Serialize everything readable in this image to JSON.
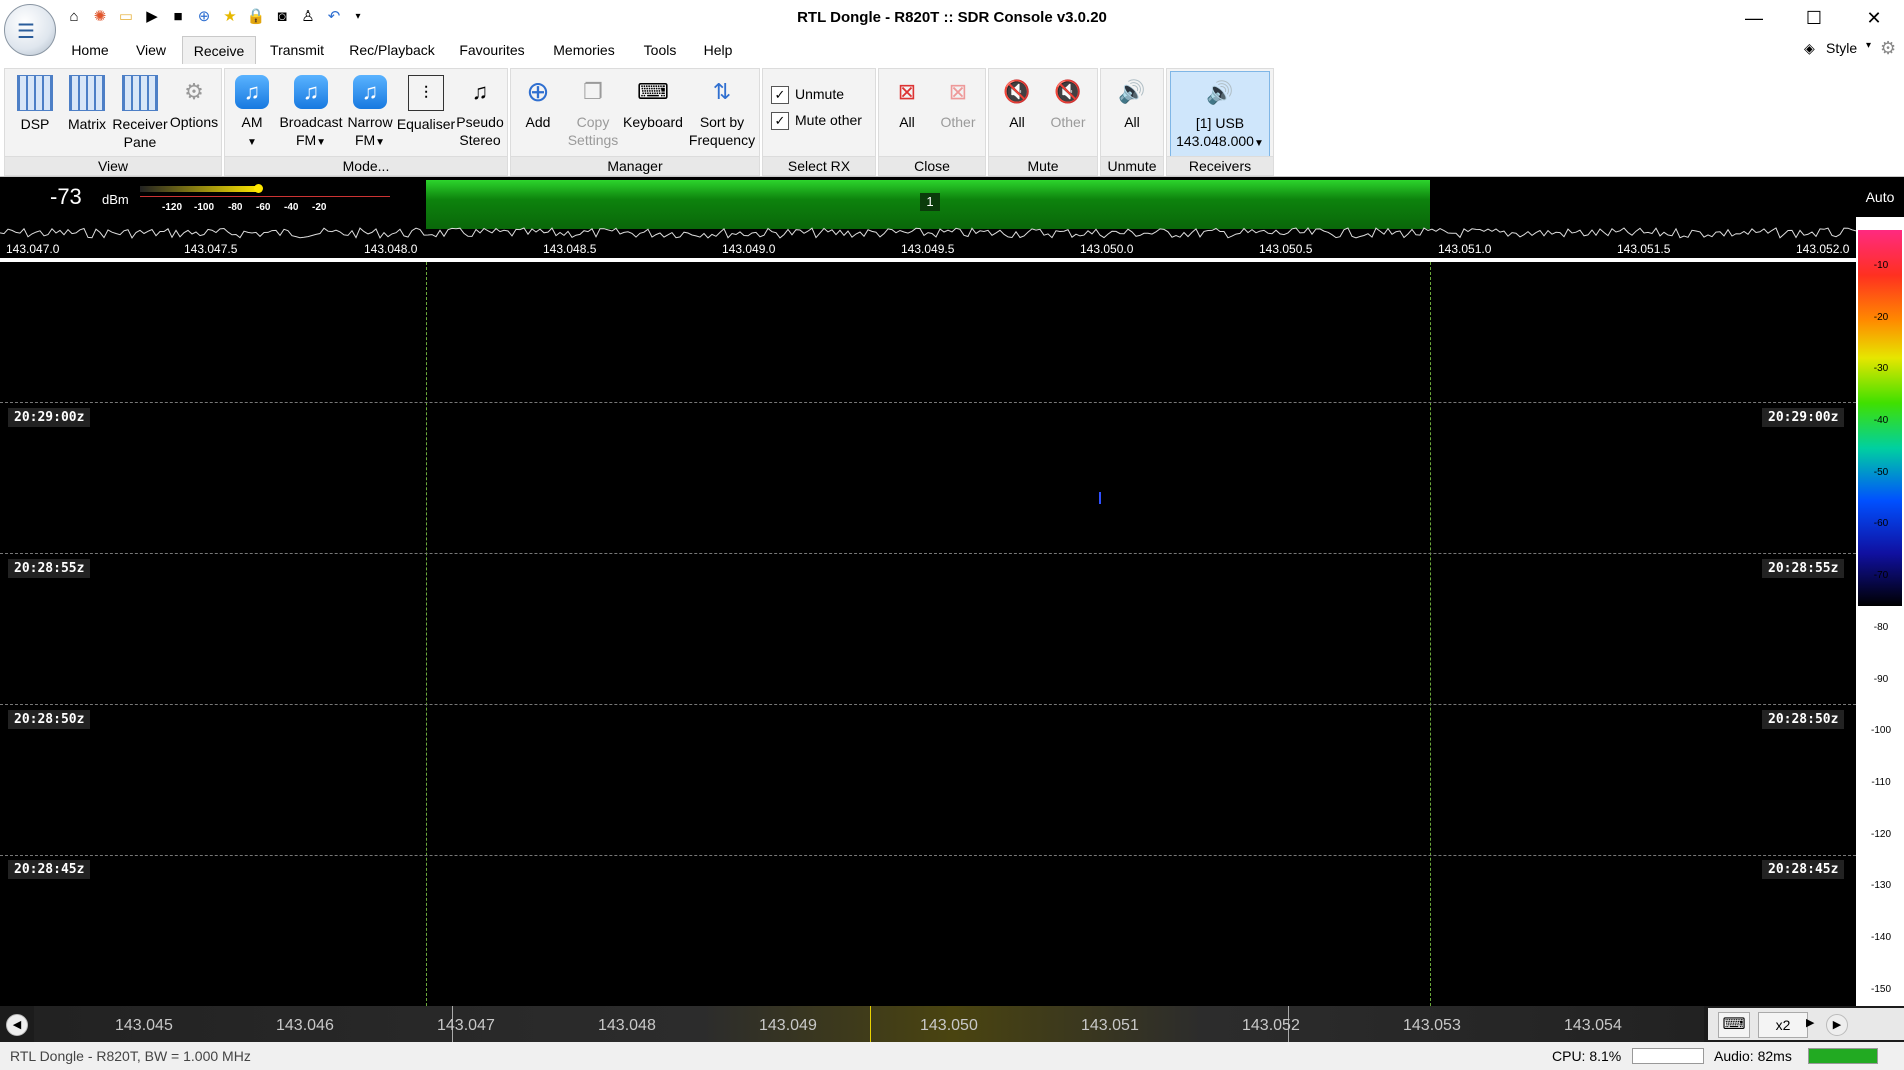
{
  "window": {
    "title": "RTL Dongle - R820T :: SDR Console v3.0.20",
    "minimize": "—",
    "maximize": "☐",
    "close": "✕"
  },
  "tabs": [
    "Home",
    "View",
    "Receive",
    "Transmit",
    "Rec/Playback",
    "Favourites",
    "Memories",
    "Tools",
    "Help"
  ],
  "active_tab": "Receive",
  "style_label": "Style",
  "ribbon": {
    "view": {
      "label": "View",
      "buttons": [
        "DSP",
        "Matrix",
        "Receiver\nPane",
        "Options"
      ]
    },
    "mode": {
      "label": "Mode...",
      "am": "AM",
      "broadcast": "Broadcast",
      "broadcast2": "FM",
      "narrow": "Narrow",
      "narrow2": "FM",
      "equaliser": "Equaliser",
      "pseudo": "Pseudo",
      "pseudo2": "Stereo"
    },
    "manager": {
      "label": "Manager",
      "add": "Add",
      "copy": "Copy",
      "copy2": "Settings",
      "keyboard": "Keyboard",
      "sort": "Sort by",
      "sort2": "Frequency"
    },
    "select_rx": {
      "label": "Select RX",
      "unmute": "Unmute",
      "mute_other": "Mute other",
      "unmute_checked": true,
      "mute_other_checked": true
    },
    "close": {
      "label": "Close",
      "all": "All",
      "other": "Other"
    },
    "mute": {
      "label": "Mute",
      "all": "All",
      "other": "Other"
    },
    "unmute": {
      "label": "Unmute",
      "all": "All"
    },
    "receivers": {
      "label": "Receivers",
      "line1": "[1]  USB",
      "line2": "143.048.000"
    }
  },
  "smeter": {
    "value": "-73",
    "unit": "dBm",
    "scale": [
      "-120",
      "-100",
      "-80",
      "-60",
      "-40",
      "-20"
    ]
  },
  "receiver_band_label": "1",
  "auto_label": "Auto",
  "top_axis": [
    "143.047.0",
    "143.047.5",
    "143.048.0",
    "143.048.5",
    "143.049.0",
    "143.049.5",
    "143.050.0",
    "143.050.5",
    "143.051.0",
    "143.051.5",
    "143.052.0"
  ],
  "waterfall_times": [
    "20:29:00z",
    "20:28:55z",
    "20:28:50z",
    "20:28:45z"
  ],
  "db_scale": [
    "-10",
    "-20",
    "-30",
    "-40",
    "-50",
    "-60",
    "-70",
    "-80",
    "-90",
    "-100",
    "-110",
    "-120",
    "-130",
    "-140",
    "-150"
  ],
  "bottom_ruler": [
    "143.045",
    "143.046",
    "143.047",
    "143.048",
    "143.049",
    "143.050",
    "143.051",
    "143.052",
    "143.053",
    "143.054"
  ],
  "zoom": "x2",
  "status": {
    "left": "RTL Dongle - R820T, BW = 1.000 MHz",
    "cpu": "CPU: 8.1%",
    "cpu_fraction": 0.0,
    "audio": "Audio: 82ms",
    "audio_fraction": 1.0
  },
  "colors": {
    "band": "#1aa51a",
    "waterfall": "#000000",
    "grid": "#6aa83a"
  }
}
